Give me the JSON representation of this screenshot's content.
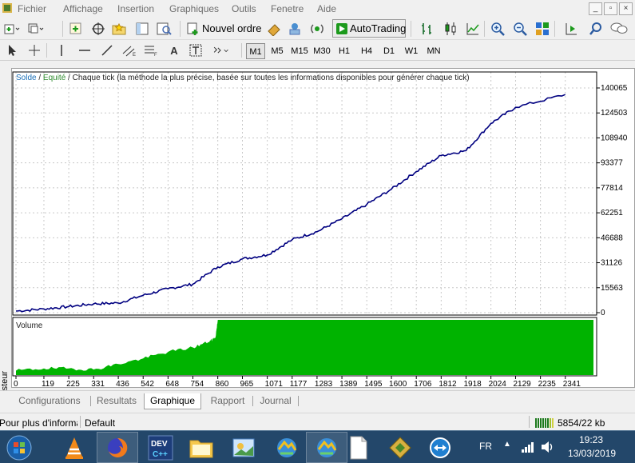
{
  "menu": [
    "Fichier",
    "Affichage",
    "Insertion",
    "Graphiques",
    "Outils",
    "Fenetre",
    "Aide"
  ],
  "toolbar": {
    "new_order": "Nouvel ordre",
    "autotrading": "AutoTrading"
  },
  "timeframes": [
    "M1",
    "M5",
    "M15",
    "M30",
    "H1",
    "H4",
    "D1",
    "W1",
    "MN"
  ],
  "selected_timeframe": "M1",
  "chart_header": {
    "solde": "Solde",
    "equite": "Equité",
    "mode": "Chaque tick (la méthode la plus précise, basée sur toutes les informations disponibles pour générer chaque tick)"
  },
  "volume_label": "Volume",
  "vertical_tab": "Testeur",
  "tabs": [
    "Configurations",
    "Resultats",
    "Graphique",
    "Rapport",
    "Journal"
  ],
  "active_tab": "Graphique",
  "status": {
    "help": "Pour plus d'informa",
    "profile": "Default",
    "traffic": "5854/22 kb"
  },
  "taskbar": {
    "lang": "FR",
    "time": "19:23",
    "date": "13/03/2019"
  },
  "colors": {
    "balance_line": "#000080",
    "volume_fill": "#00b300",
    "solde_label": "#1b6fb7",
    "equite_label": "#2e8b2e"
  },
  "chart_data": [
    {
      "type": "line",
      "title": "",
      "series": [
        {
          "name": "Solde",
          "values": [
            1000,
            2300,
            3800,
            5500,
            6000,
            10800,
            14900,
            17800,
            28500,
            33500,
            36000,
            45500,
            50500,
            58500,
            67500,
            77000,
            88000,
            98000,
            101000,
            118000,
            128000,
            136000
          ]
        }
      ],
      "x": [
        0,
        119,
        225,
        331,
        436,
        542,
        648,
        754,
        860,
        965,
        1071,
        1177,
        1283,
        1389,
        1495,
        1600,
        1706,
        1812,
        1918,
        2024,
        2129,
        2341
      ],
      "x_ticks": [
        0,
        119,
        225,
        331,
        436,
        542,
        648,
        754,
        860,
        965,
        1071,
        1177,
        1283,
        1389,
        1495,
        1600,
        1706,
        1812,
        1918,
        2024,
        2129,
        2235,
        2341
      ],
      "y_ticks": [
        0,
        15563,
        31126,
        46688,
        62251,
        77814,
        93377,
        108940,
        124503,
        140065
      ],
      "ylim": [
        0,
        140065
      ],
      "xlim": [
        0,
        2461
      ],
      "grid": true,
      "xlabel": "",
      "ylabel": ""
    },
    {
      "type": "area",
      "title": "Volume",
      "series": [
        {
          "name": "Volume",
          "values": [
            0.08,
            0.12,
            0.12,
            0.1,
            0.2,
            0.3,
            0.42,
            0.5,
            0.6,
            0.68,
            1.0,
            1.0
          ]
        }
      ],
      "x": [
        0,
        119,
        225,
        331,
        436,
        542,
        648,
        754,
        820,
        850,
        860,
        2461
      ],
      "ylim": [
        0,
        1
      ],
      "grid": false
    }
  ]
}
